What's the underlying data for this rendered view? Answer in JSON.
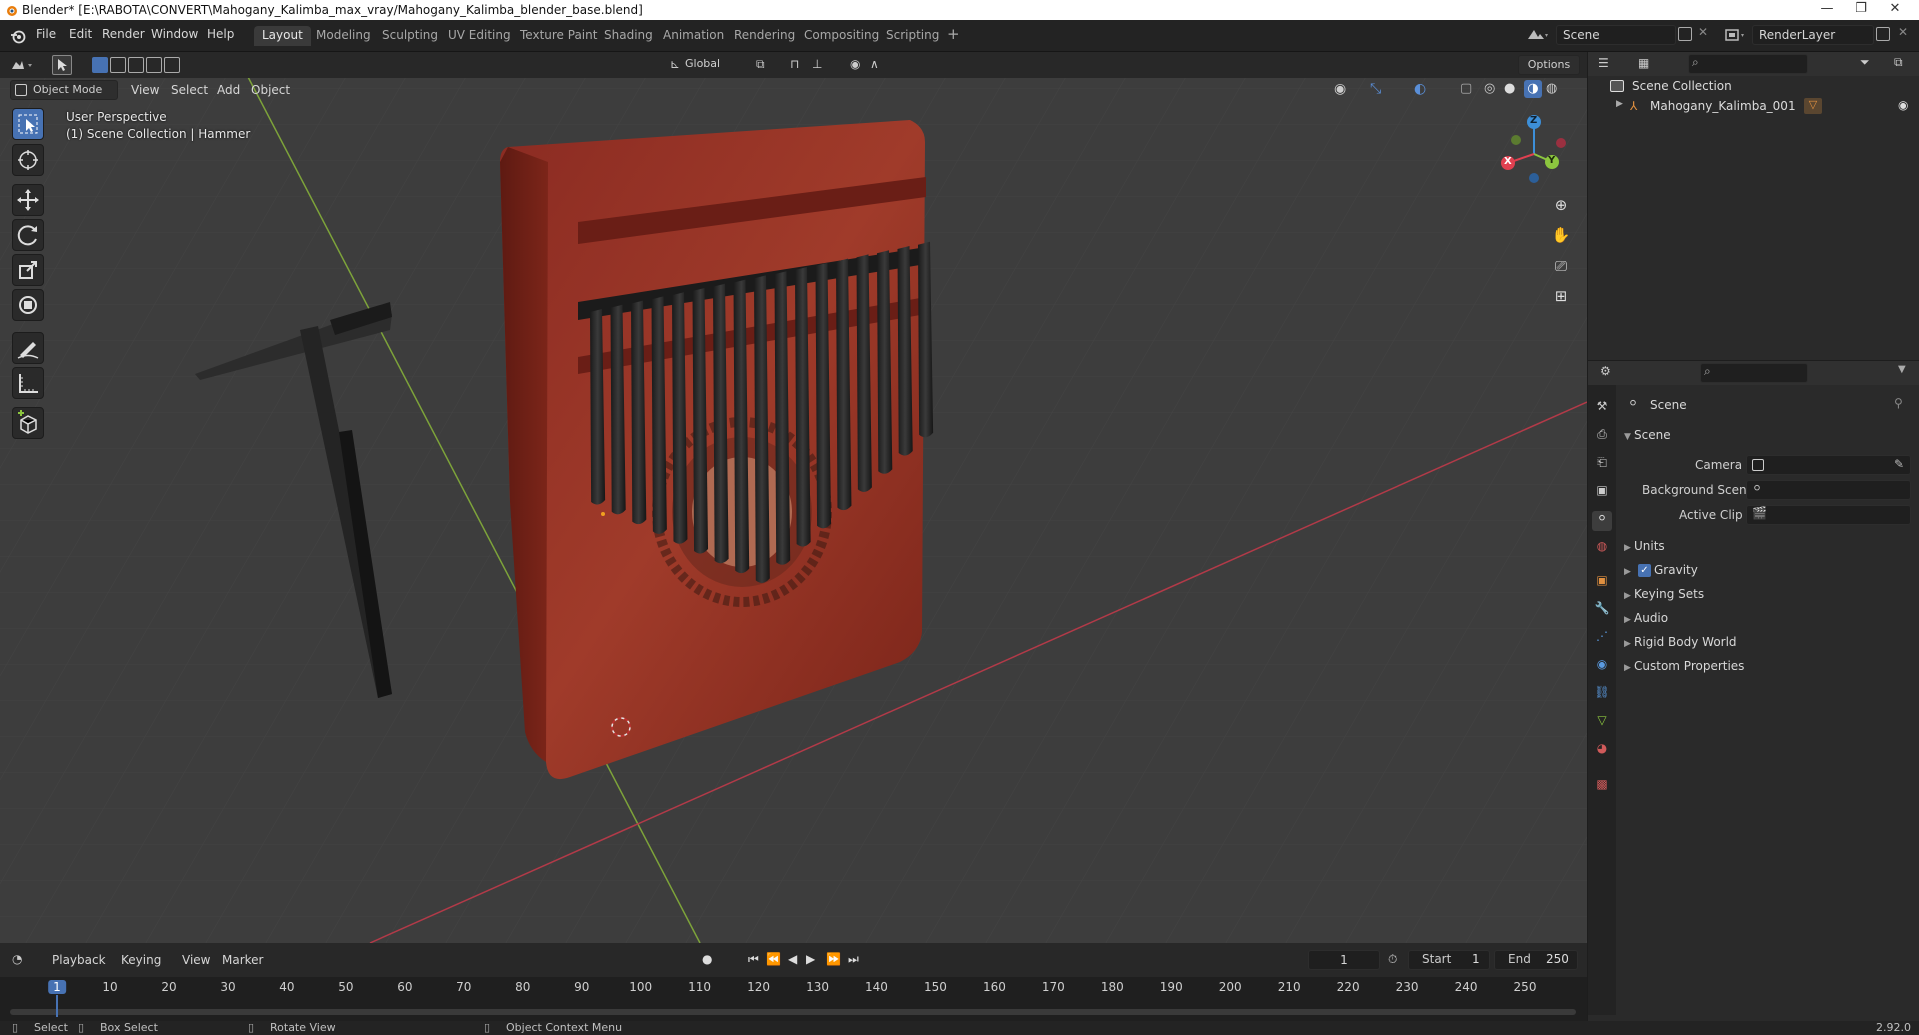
{
  "titlebar": {
    "title": "Blender* [E:\\RABOTA\\CONVERT\\Mahogany_Kalimba_max_vray/Mahogany_Kalimba_blender_base.blend]",
    "minimize": "—",
    "maximize": "❐",
    "close": "✕"
  },
  "menu": {
    "file": "File",
    "edit": "Edit",
    "render": "Render",
    "window": "Window",
    "help": "Help"
  },
  "workspaces": [
    "Layout",
    "Modeling",
    "Sculpting",
    "UV Editing",
    "Texture Paint",
    "Shading",
    "Animation",
    "Rendering",
    "Compositing",
    "Scripting"
  ],
  "workspace_add": "+",
  "scene_field": "Scene",
  "renderlayer_field": "RenderLayer",
  "toolheader": {
    "transform_orientation": "Global",
    "options": "Options"
  },
  "viewport_header": {
    "mode": "Object Mode",
    "view": "View",
    "select": "Select",
    "add": "Add",
    "object": "Object"
  },
  "viewport_overlay": {
    "line1": "User Perspective",
    "line2": "(1) Scene Collection | Hammer"
  },
  "gizmo": {
    "z": "Z",
    "y": "Y",
    "x": "X"
  },
  "outliner": {
    "root": "Scene Collection",
    "items": [
      {
        "label": "Mahogany_Kalimba_001"
      }
    ]
  },
  "properties": {
    "context": "Scene",
    "panel_title": "Scene",
    "camera_label": "Camera",
    "background_label": "Background Scene",
    "clip_label": "Active Clip",
    "sections": [
      "Units",
      "Gravity",
      "Keying Sets",
      "Audio",
      "Rigid Body World",
      "Custom Properties"
    ],
    "gravity_checked": true
  },
  "timeline": {
    "playback": "Playback",
    "keying": "Keying",
    "view": "View",
    "marker": "Marker",
    "current_frame": "1",
    "start_label": "Start",
    "start_value": "1",
    "end_label": "End",
    "end_value": "250",
    "ruler": [
      "1",
      "10",
      "20",
      "30",
      "40",
      "50",
      "60",
      "70",
      "80",
      "90",
      "100",
      "110",
      "120",
      "130",
      "140",
      "150",
      "160",
      "170",
      "180",
      "190",
      "200",
      "210",
      "220",
      "230",
      "240",
      "250"
    ]
  },
  "statusbar": {
    "select": "Select",
    "box_select": "Box Select",
    "rotate_view": "Rotate View",
    "context_menu": "Object Context Menu",
    "version": "2.92.0"
  },
  "colors": {
    "accent": "#4772b3",
    "wood": "#8a2a1e",
    "tine": "#2a2a2a",
    "x_axis": "#e04050",
    "y_axis": "#8cc63f",
    "z_axis": "#3d8fd8"
  }
}
